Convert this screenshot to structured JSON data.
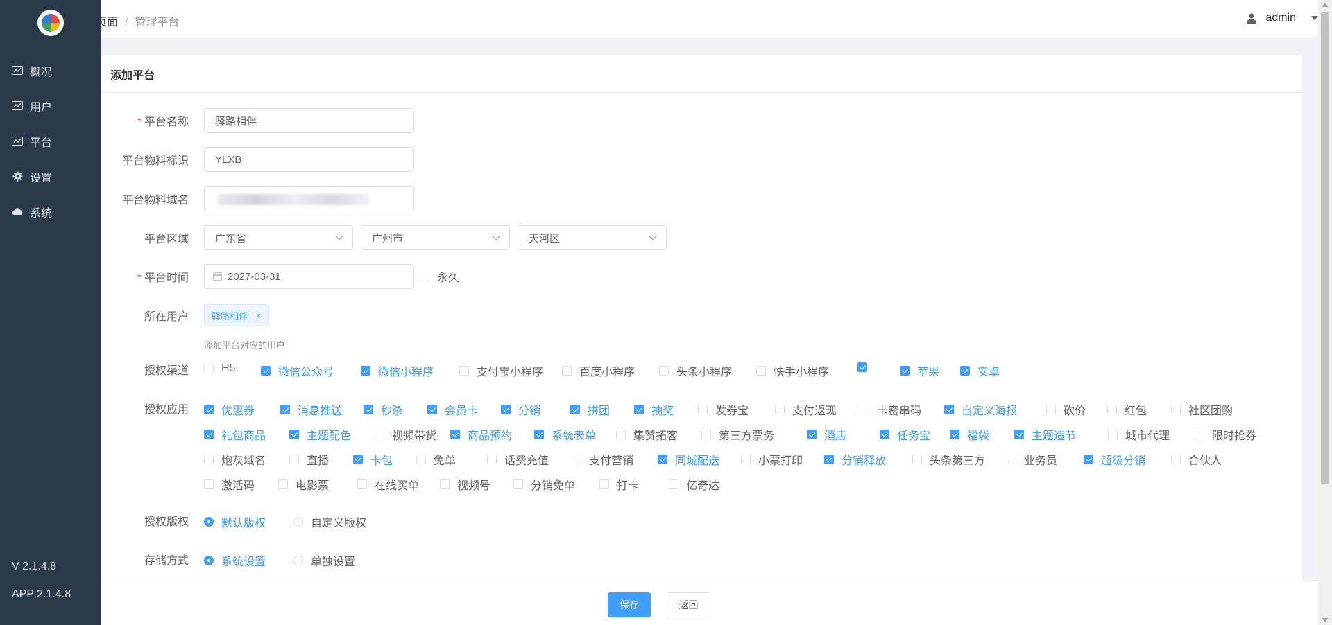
{
  "breadcrumb": {
    "home": "页面",
    "sep": "/",
    "current": "管理平台"
  },
  "user": {
    "name": "admin"
  },
  "sidebar": {
    "items": [
      {
        "label": "概况",
        "icon": "chart-icon"
      },
      {
        "label": "用户",
        "icon": "chart-icon"
      },
      {
        "label": "平台",
        "icon": "chart-icon"
      },
      {
        "label": "设置",
        "icon": "gear-icon"
      },
      {
        "label": "系统",
        "icon": "cloud-icon"
      }
    ],
    "version": "V 2.1.4.8",
    "app_version": "APP 2.1.4.8"
  },
  "page": {
    "title": "添加平台"
  },
  "form": {
    "name_label": "平台名称",
    "name_value": "驿路相伴",
    "mark_label": "平台物料标识",
    "mark_value": "YLXB",
    "domain_label": "平台物料域名",
    "region_label": "平台区域",
    "province": "广东省",
    "city": "广州市",
    "district": "天河区",
    "time_label": "平台时间",
    "date_value": "2027-03-31",
    "forever_label": "永久",
    "user_label": "所在用户",
    "user_tag": "驿路相伴",
    "user_hint": "添加平台对应的用户",
    "channel_label": "授权渠道",
    "app_label": "授权应用",
    "copyright_label": "授权版权",
    "storage_label": "存储方式"
  },
  "channels": [
    {
      "label": "H5",
      "checked": false
    },
    {
      "label": "微信公众号",
      "checked": true
    },
    {
      "label": "微信小程序",
      "checked": true
    },
    {
      "label": "支付宝小程序",
      "checked": false
    },
    {
      "label": "百度小程序",
      "checked": false
    },
    {
      "label": "头条小程序",
      "checked": false
    },
    {
      "label": "快手小程序",
      "checked": false
    },
    {
      "label": "",
      "checked": true
    },
    {
      "label": "苹果",
      "checked": true
    },
    {
      "label": "安卓",
      "checked": true
    }
  ],
  "apps": [
    [
      {
        "label": "优惠券",
        "checked": true
      },
      {
        "label": "消息推送",
        "checked": true
      },
      {
        "label": "秒杀",
        "checked": true
      },
      {
        "label": "会员卡",
        "checked": true
      },
      {
        "label": "分销",
        "checked": true
      },
      {
        "label": "拼团",
        "checked": true
      },
      {
        "label": "抽奖",
        "checked": true
      },
      {
        "label": "发券宝",
        "checked": false
      },
      {
        "label": "支付返现",
        "checked": false
      },
      {
        "label": "卡密串码",
        "checked": false
      },
      {
        "label": "自定义海报",
        "checked": true
      },
      {
        "label": "砍价",
        "checked": false
      },
      {
        "label": "红包",
        "checked": false
      },
      {
        "label": "社区团购",
        "checked": false
      }
    ],
    [
      {
        "label": "礼包商品",
        "checked": true
      },
      {
        "label": "主题配色",
        "checked": true
      },
      {
        "label": "视频带货",
        "checked": false
      },
      {
        "label": "商品预约",
        "checked": true
      },
      {
        "label": "系统表单",
        "checked": true
      },
      {
        "label": "集赞拓客",
        "checked": false
      },
      {
        "label": "第三方票务",
        "checked": false
      },
      {
        "label": "酒店",
        "checked": true
      },
      {
        "label": "任务宝",
        "checked": true
      },
      {
        "label": "福袋",
        "checked": true
      },
      {
        "label": "主题造节",
        "checked": true
      },
      {
        "label": "城市代理",
        "checked": false
      },
      {
        "label": "限时抢券",
        "checked": false
      }
    ],
    [
      {
        "label": "炮灰域名",
        "checked": false
      },
      {
        "label": "直播",
        "checked": false
      },
      {
        "label": "卡包",
        "checked": true
      },
      {
        "label": "免单",
        "checked": false
      },
      {
        "label": "话费充值",
        "checked": false
      },
      {
        "label": "支付营销",
        "checked": false
      },
      {
        "label": "同城配送",
        "checked": true
      },
      {
        "label": "小票打印",
        "checked": false
      },
      {
        "label": "分销释放",
        "checked": true
      },
      {
        "label": "头条第三方",
        "checked": false
      },
      {
        "label": "业务员",
        "checked": false
      },
      {
        "label": "超级分销",
        "checked": true
      },
      {
        "label": "合伙人",
        "checked": false
      }
    ],
    [
      {
        "label": "激活码",
        "checked": false
      },
      {
        "label": "电影票",
        "checked": false
      },
      {
        "label": "在线买单",
        "checked": false
      },
      {
        "label": "视频号",
        "checked": false
      },
      {
        "label": "分销免单",
        "checked": false
      },
      {
        "label": "打卡",
        "checked": false
      },
      {
        "label": "亿奇达",
        "checked": false
      }
    ]
  ],
  "copyright": [
    {
      "label": "默认版权",
      "checked": true
    },
    {
      "label": "自定义版权",
      "checked": false
    }
  ],
  "storage": [
    {
      "label": "系统设置",
      "checked": true
    },
    {
      "label": "单独设置",
      "checked": false
    }
  ],
  "buttons": {
    "save": "保存",
    "back": "返回"
  },
  "colors": {
    "primary": "#409eff",
    "sidebar": "#2b3a4a",
    "required": "#f56c6c"
  }
}
